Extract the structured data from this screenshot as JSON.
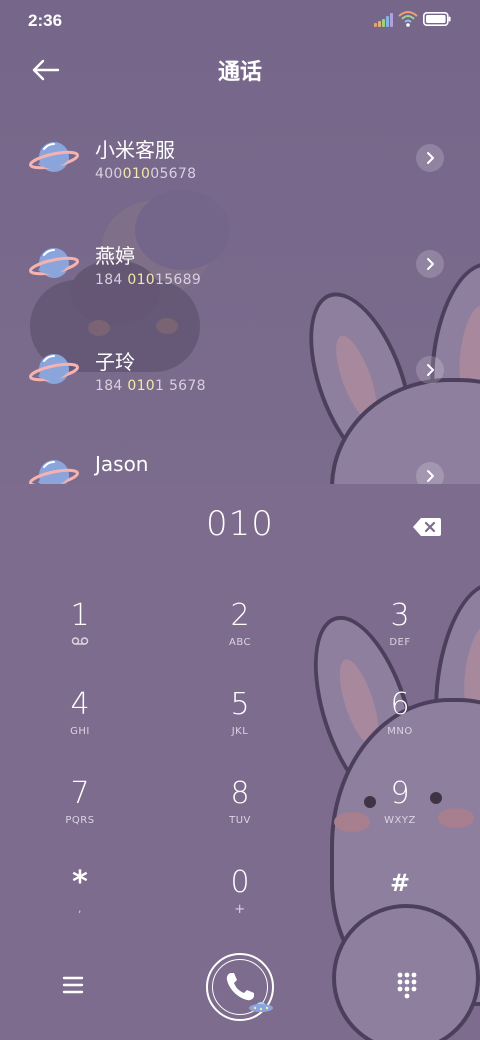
{
  "status_bar": {
    "time": "2:36",
    "icons": [
      "signal-icon",
      "wifi-icon",
      "battery-icon"
    ]
  },
  "header": {
    "title": "通话",
    "back_icon": "arrow-left-icon"
  },
  "contacts": [
    {
      "name": "小米客服",
      "number_pre": "400",
      "number_match": "010",
      "number_post": "05678"
    },
    {
      "name": "燕婷",
      "number_pre": "184 ",
      "number_match": "010",
      "number_post": "15689"
    },
    {
      "name": "子玲",
      "number_pre": "184 ",
      "number_match": "010",
      "number_post": "1 5678"
    },
    {
      "name": "Jason",
      "number_pre": "",
      "number_match": "",
      "number_post": ""
    }
  ],
  "dial": {
    "value": "010",
    "delete_icon": "backspace-icon"
  },
  "keypad": [
    {
      "digit": "1",
      "letters": ""
    },
    {
      "digit": "2",
      "letters": "ABC"
    },
    {
      "digit": "3",
      "letters": "DEF"
    },
    {
      "digit": "4",
      "letters": "GHI"
    },
    {
      "digit": "5",
      "letters": "JKL"
    },
    {
      "digit": "6",
      "letters": "MNO"
    },
    {
      "digit": "7",
      "letters": "PQRS"
    },
    {
      "digit": "8",
      "letters": "TUV"
    },
    {
      "digit": "9",
      "letters": "WXYZ"
    },
    {
      "digit": "*",
      "letters": ","
    },
    {
      "digit": "0",
      "letters": "+"
    },
    {
      "digit": "#",
      "letters": ""
    }
  ],
  "bottom_bar": {
    "menu_icon": "menu-icon",
    "call_icon": "phone-icon",
    "keypad_icon": "dialpad-icon"
  },
  "colors": {
    "background": "#7d6c8d",
    "match_highlight": "#f4e9a4",
    "text": "#ffffff"
  }
}
